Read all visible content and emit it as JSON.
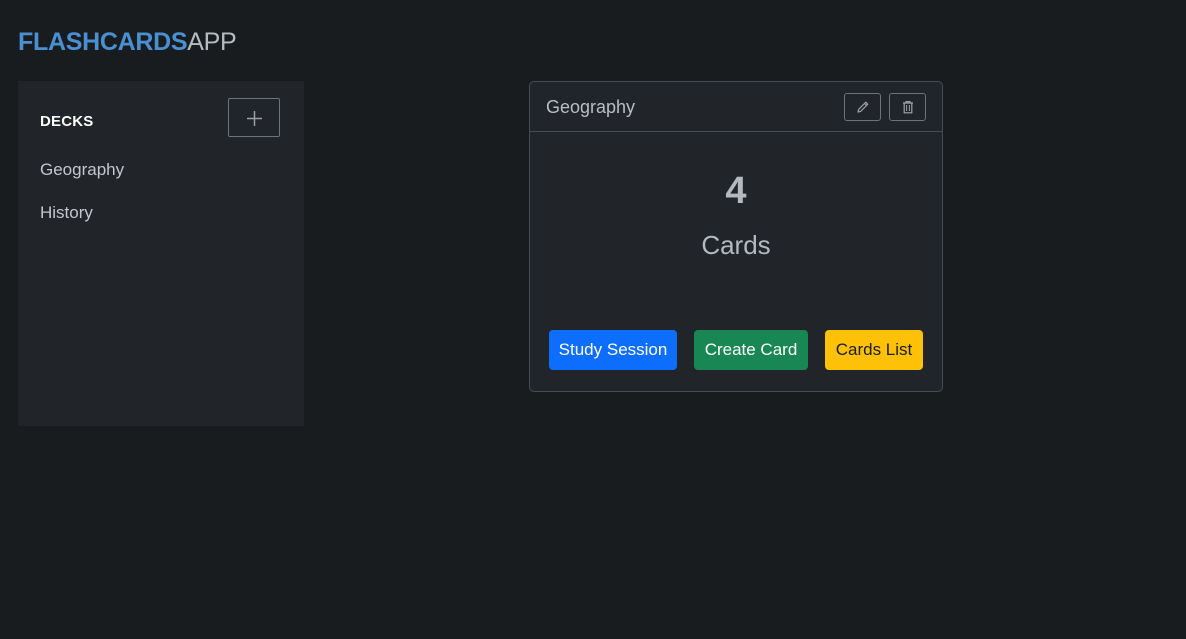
{
  "brand": {
    "strong": "FLASHCARDS",
    "light": "APP",
    "accent_color": "#4a8fd1"
  },
  "sidebar": {
    "title": "DECKS",
    "add_icon": "plus-icon",
    "decks": [
      {
        "label": "Geography"
      },
      {
        "label": "History"
      }
    ]
  },
  "deck_card": {
    "title": "Geography",
    "edit_icon": "pencil-icon",
    "delete_icon": "trash-icon",
    "count": "4",
    "count_label": "Cards",
    "buttons": {
      "study": "Study Session",
      "create": "Create Card",
      "list": "Cards List"
    }
  },
  "colors": {
    "background": "#191c1f",
    "panel": "#212429",
    "primary": "#0d6efd",
    "success": "#198754",
    "warning": "#ffc107"
  }
}
